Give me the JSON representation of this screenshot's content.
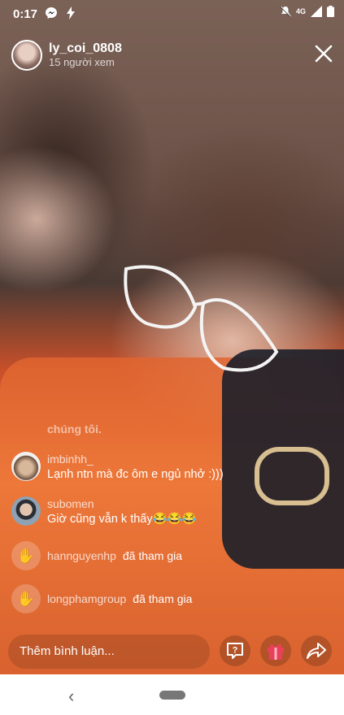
{
  "status_bar": {
    "time": "0:17",
    "network": "4G",
    "icons": [
      "messenger-icon",
      "bolt-icon",
      "mute-icon",
      "signal-icon",
      "battery-icon"
    ]
  },
  "header": {
    "host_name": "ly_coi_0808",
    "viewer_count": "15 người xem"
  },
  "comments": {
    "faded_text": "chúng tôi.",
    "items": [
      {
        "user": "imbinhh_",
        "text": "Lạnh ntn mà đc ôm e ngủ nhở :)))"
      },
      {
        "user": "subomen",
        "text": "Giờ cũng vẫn k thấy😂😂😂"
      }
    ],
    "joins": [
      {
        "user": "hannguyenhp",
        "text": "đã tham gia"
      },
      {
        "user": "longphamgroup",
        "text": "đã tham gia"
      }
    ]
  },
  "bottom": {
    "comment_placeholder": "Thêm bình luận...",
    "accent_gift": "#e8405a"
  }
}
